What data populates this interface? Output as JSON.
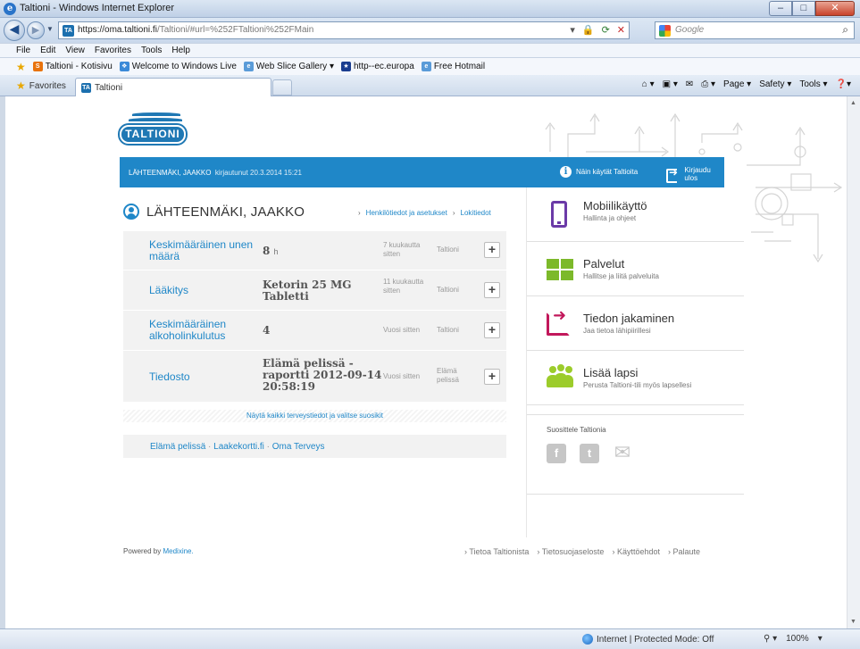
{
  "window": {
    "title": "Taltioni - Windows Internet Explorer",
    "buttons": {
      "minimize": "–",
      "maximize": "□",
      "close": "✕"
    }
  },
  "address": {
    "url_prefix": "https://",
    "url_domain": "oma.taltioni.fi",
    "url_path": "/Taltioni/#url=%252FTaltioni%252FMain",
    "favicon": "TA",
    "search_placeholder": "Google"
  },
  "menu": [
    "File",
    "Edit",
    "View",
    "Favorites",
    "Tools",
    "Help"
  ],
  "favorites_bar": [
    "Taltioni - Kotisivu",
    "Welcome to Windows Live",
    "Web Slice Gallery ▾",
    "http--ec.europa",
    "Free Hotmail"
  ],
  "tabs": {
    "favorites_label": "Favorites",
    "active_tab": "Taltioni"
  },
  "command_bar": [
    "Page ▾",
    "Safety ▾",
    "Tools ▾"
  ],
  "page": {
    "logo_text": "TALTIONI",
    "bluebar": {
      "user": "LÄHTEENMÄKI, JAAKKO",
      "login": "kirjautunut 20.3.2014 15:21",
      "help": "Näin käytät Taltioita",
      "logout": "Kirjaudu ulos"
    },
    "person_name": "LÄHTEENMÄKI, JAAKKO",
    "links": [
      "Henkilötiedot ja asetukset",
      "Lokitiedot"
    ],
    "records": [
      {
        "label": "Keskimääräinen unen määrä",
        "value": "8",
        "unit": "h",
        "when": "7 kuukautta sitten",
        "source": "Taltioni"
      },
      {
        "label": "Lääkitys",
        "value": "Ketorin 25 MG Tabletti",
        "unit": "",
        "when": "11 kuukautta sitten",
        "source": "Taltioni"
      },
      {
        "label": "Keskimääräinen alkoholinkulutus",
        "value": "4",
        "unit": "",
        "when": "Vuosi sitten",
        "source": "Taltioni"
      },
      {
        "label": "Tiedosto",
        "value": "Elämä pelissä - raportti 2012-09-14 20:58:19",
        "unit": "",
        "when": "Vuosi sitten",
        "source": "Elämä pelissä"
      }
    ],
    "show_all": "Näytä kaikki terveystiedot ja valitse suosikit",
    "bottom_links": [
      "Elämä pelissä",
      "Laakekortti.fi",
      "Oma Terveys"
    ],
    "side_cards": [
      {
        "title": "Mobiilikäyttö",
        "subtitle": "Hallinta ja ohjeet"
      },
      {
        "title": "Palvelut",
        "subtitle": "Hallitse ja liitä palveluita"
      },
      {
        "title": "Tiedon jakaminen",
        "subtitle": "Jaa tietoa lähipiirillesi"
      },
      {
        "title": "Lisää lapsi",
        "subtitle": "Perusta Taltioni-tili myös lapsellesi"
      }
    ],
    "recommend": "Suosittele Taltionia",
    "powered_prefix": "Powered by",
    "powered_link": "Medixine.",
    "footer_links": [
      "Tietoa Taltionista",
      "Tietosuojaseloste",
      "Käyttöehdot",
      "Palaute"
    ]
  },
  "status": {
    "zone": "Internet | Protected Mode: Off",
    "zoom": "100%"
  },
  "colors": {
    "brand_blue": "#1f87c8",
    "mobile_purple": "#6b3aa7",
    "services_green": "#7cb92a",
    "share_magenta": "#c2185b",
    "kids_green": "#9ccc2b"
  }
}
